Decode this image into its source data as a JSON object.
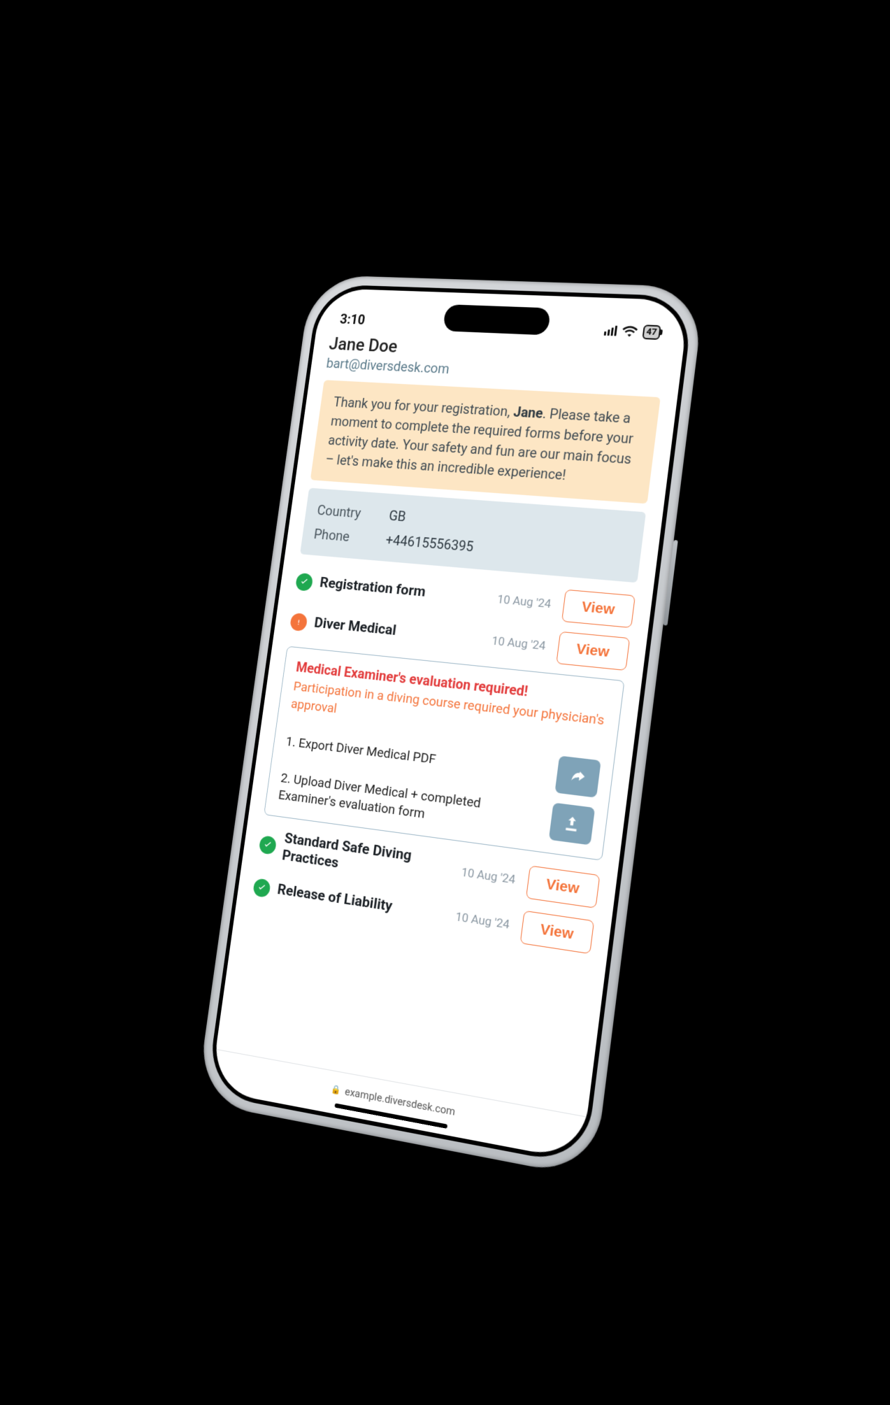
{
  "status_bar": {
    "time": "3:10",
    "battery": "47"
  },
  "user": {
    "name": "Jane Doe",
    "email": "bart@diversdesk.com"
  },
  "banner": {
    "prefix": "Thank you for your registration, ",
    "name": "Jane",
    "rest": ". Please take a moment to complete the required forms before your activity date. Your safety and fun are our main focus – let's make this an incredible experience!"
  },
  "info": {
    "country_label": "Country",
    "country_value": "GB",
    "phone_label": "Phone",
    "phone_value": "+44615556395"
  },
  "forms": {
    "view_label": "View",
    "items": [
      {
        "title": "Registration form",
        "date": "10 Aug '24",
        "status": "ok"
      },
      {
        "title": "Diver Medical",
        "date": "10 Aug '24",
        "status": "warn"
      },
      {
        "title": "Standard Safe Diving Practices",
        "date": "10 Aug '24",
        "status": "ok"
      },
      {
        "title": "Release of Liability",
        "date": "10 Aug '24",
        "status": "ok"
      }
    ]
  },
  "medical_alert": {
    "title": "Medical Examiner's evaluation required!",
    "subtitle": "Participation in a diving course required your physician's approval",
    "step1": "1. Export Diver Medical PDF",
    "step2": "2. Upload Diver Medical + completed Examiner's evaluation form"
  },
  "browser": {
    "url": "example.diversdesk.com"
  }
}
